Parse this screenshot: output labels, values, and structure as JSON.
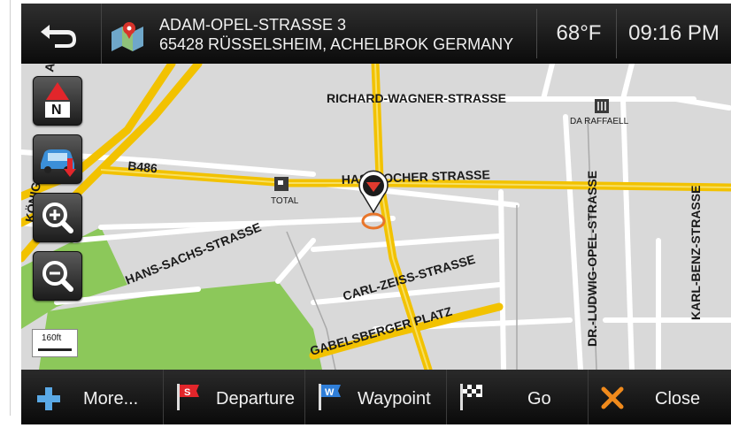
{
  "header": {
    "address_line1": "ADAM-OPEL-STRASSE 3",
    "address_line2": "65428 RÜSSELSHEIM, ACHELBROK GERMANY",
    "temperature": "68°F",
    "time": "09:16 PM"
  },
  "map": {
    "streets": {
      "richard": "RICHARD-WAGNER-STRASSE",
      "hasslocher": "HASSLOCHER STRASSE",
      "b486": "B486",
      "hans": "HANS-SACHS-STRASSE",
      "carl": "CARL-ZEISS-STRASSE",
      "gabels": "GABELSBERGER PLATZ",
      "ludwig": "DR.-LUDWIG-OPEL-STRASSE",
      "benz": "KARL-BENZ-STRASSE",
      "konig": "KÖNIG",
      "left_a": "A"
    },
    "pois": {
      "restaurant": "DA RAFFAELL",
      "fuel": "TOTAL"
    },
    "scale": "160ft"
  },
  "controls": {
    "north_letter": "N"
  },
  "toolbar": {
    "more": "More...",
    "departure": "Departure",
    "waypoint": "Waypoint",
    "go": "Go",
    "close": "Close"
  },
  "colors": {
    "road_major": "#f2c200",
    "road_minor": "#ffffff",
    "map_bg": "#d9d9d9",
    "park": "#8cc85a",
    "route_marker": "#e8752a"
  }
}
